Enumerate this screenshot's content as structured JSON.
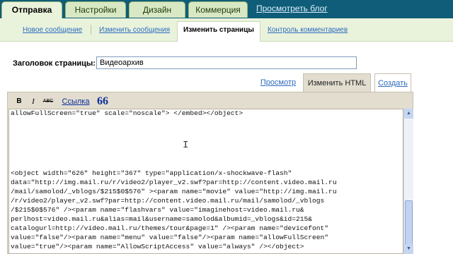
{
  "top_tabs": [
    {
      "label": "Отправка",
      "active": true
    },
    {
      "label": "Настройки",
      "active": false
    },
    {
      "label": "Дизайн",
      "active": false
    },
    {
      "label": "Коммерция",
      "active": false
    }
  ],
  "blog_link": "Просмотреть блог",
  "sub_tabs": [
    {
      "label": "Новое сообщение",
      "active": false
    },
    {
      "label": "Изменить сообщения",
      "active": false
    },
    {
      "label": "Изменить страницы",
      "active": true
    },
    {
      "label": "Контроль комментариев",
      "active": false
    }
  ],
  "page_title": {
    "label": "Заголовок страницы:",
    "value": "Видеоархив"
  },
  "editor_modes": {
    "preview": "Просмотр",
    "html": "Изменить HTML",
    "compose": "Создать"
  },
  "toolbar": {
    "bold": "B",
    "italic": "I",
    "strike": "ABC",
    "link": "Ссылка",
    "quote": "66"
  },
  "code_lines": [
    "allowFullScreen=\"true\" scale=\"noscale\"> </embed></object>",
    "",
    "",
    "",
    "",
    "",
    "<object width=\"626\" height=\"367\" type=\"application/x-shockwave-flash\"",
    "data=\"http://img.mail.ru/r/video2/player_v2.swf?par=http://content.video.mail.ru",
    "/mail/samolod/_vblogs/$215$0$576\" ><param name=\"movie\" value=\"http://img.mail.ru",
    "/r/video2/player_v2.swf?par=http://content.video.mail.ru/mail/samolod/_vblogs",
    "/$215$0$576\" /><param name=\"flashvars\" value=\"imaginehost=video.mail.ru&",
    "perlhost=video.mail.ru&alias=mail&username=samolod&albumid=_vblogs&id=215&",
    "catalogurl=http://video.mail.ru/themes/tour&page=1\" /><param name=\"devicefont\"",
    "value=\"false\"/><param name=\"menu\" value=\"false\"/><param name=\"allowFullScreen\"",
    "value=\"true\"/><param name=\"AllowScriptAccess\" value=\"always\" /></object>"
  ],
  "icons": {
    "scroll_up": "triangle-up",
    "scroll_down": "triangle-down",
    "text_cursor": "i-beam"
  },
  "colors": {
    "topbar": "#0f5d78",
    "tab_bg": "#d9e8c4",
    "subbar_bg": "#e9f3dc",
    "link": "#2d6bbd",
    "editor_frame": "#e2ddcf"
  }
}
